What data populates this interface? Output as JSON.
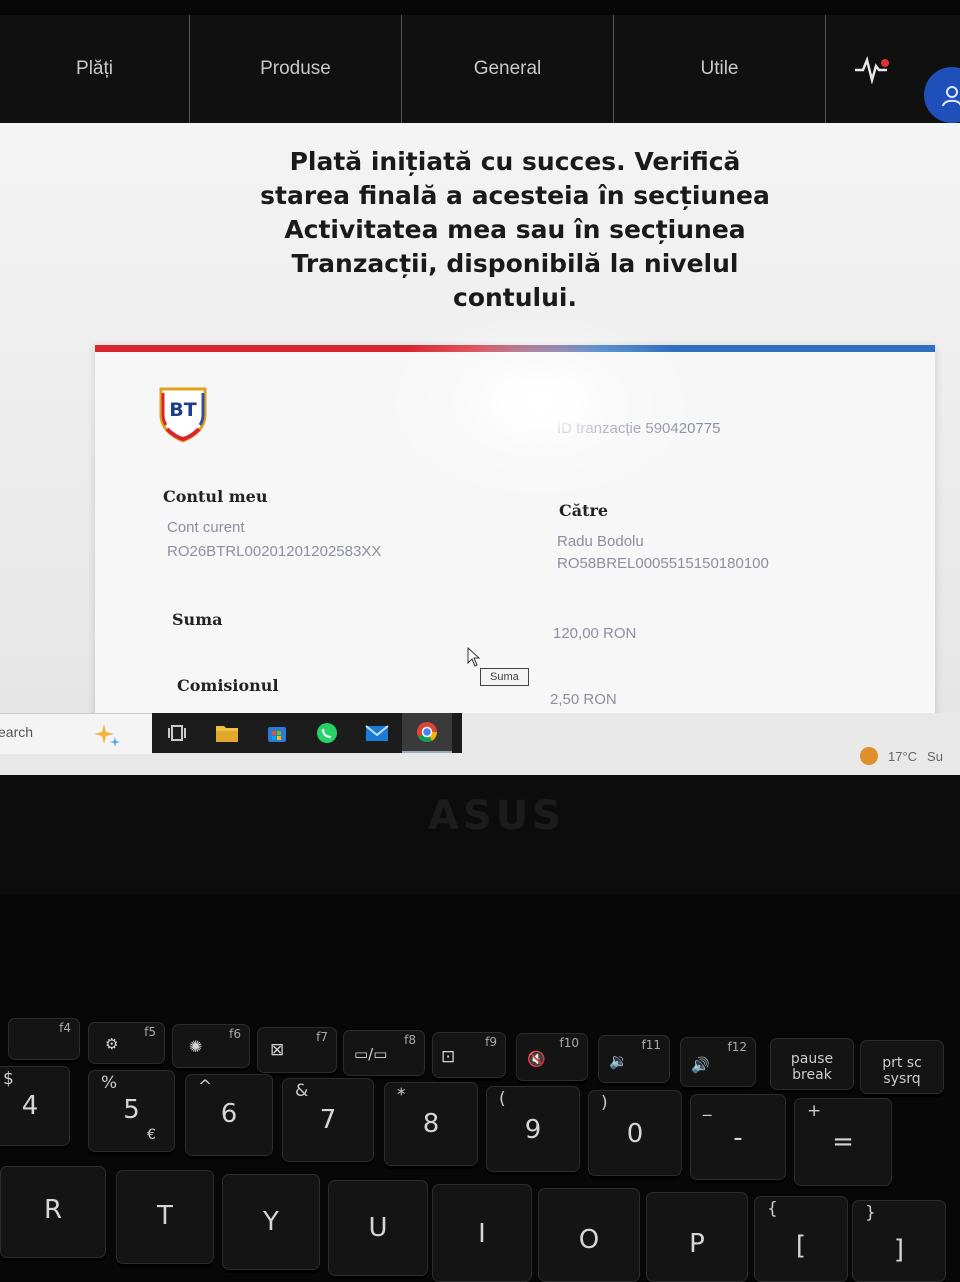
{
  "navbar": {
    "items": [
      "Plăți",
      "Produse",
      "General",
      "Utile"
    ],
    "pulse_icon": "activity-pulse-icon",
    "avatar_icon": "user-icon"
  },
  "page": {
    "success_message": "Plată inițiată cu succes. Verifică starea finală a acesteia în secțiunea Activitatea mea sau în secțiunea Tranzacții, disponibilă la nivelul contului."
  },
  "receipt": {
    "logo_text": "BT",
    "transaction_id": "ID tranzacție 590420775",
    "from": {
      "title": "Contul meu",
      "account_type": "Cont curent",
      "iban": "RO26BTRL00201201202583XX"
    },
    "to": {
      "title": "Către",
      "name": "Radu Bodolu",
      "iban": "RO58BREL0005515150180100"
    },
    "amount": {
      "title": "Suma",
      "value": "120,00 RON"
    },
    "fee": {
      "title": "Comisionul",
      "value": "2,50 RON"
    },
    "tooltip": "Suma"
  },
  "taskbar": {
    "search_text": "earch",
    "apps": [
      "task-view-icon",
      "file-explorer-icon",
      "store-icon",
      "whatsapp-icon",
      "mail-icon",
      "chrome-icon"
    ],
    "weather": "17°C",
    "weather_text": "Su"
  },
  "bezel": {
    "brand": "ASUS"
  },
  "keyboard": {
    "fn_keys": [
      "f4",
      "f5",
      "f6",
      "f7",
      "f8",
      "f9",
      "f10",
      "f11",
      "f12"
    ],
    "pause_key": [
      "pause",
      "break"
    ],
    "prtsc_key": [
      "prt sc",
      "sysrq"
    ],
    "number_keys": [
      {
        "top": "$",
        "main": "4"
      },
      {
        "top": "%",
        "main": "5",
        "extra": "€"
      },
      {
        "top": "^",
        "main": "6"
      },
      {
        "top": "&",
        "main": "7"
      },
      {
        "top": "*",
        "main": "8"
      },
      {
        "top": "(",
        "main": "9"
      },
      {
        "top": ")",
        "main": "0"
      },
      {
        "top": "_",
        "main": "-"
      },
      {
        "top": "+",
        "main": "="
      }
    ],
    "letter_keys": [
      "R",
      "T",
      "Y",
      "U",
      "I",
      "O",
      "P"
    ],
    "bracket_key": {
      "top": "{",
      "main": "["
    },
    "bracket_close_key": {
      "top": "}",
      "main": "]"
    }
  }
}
